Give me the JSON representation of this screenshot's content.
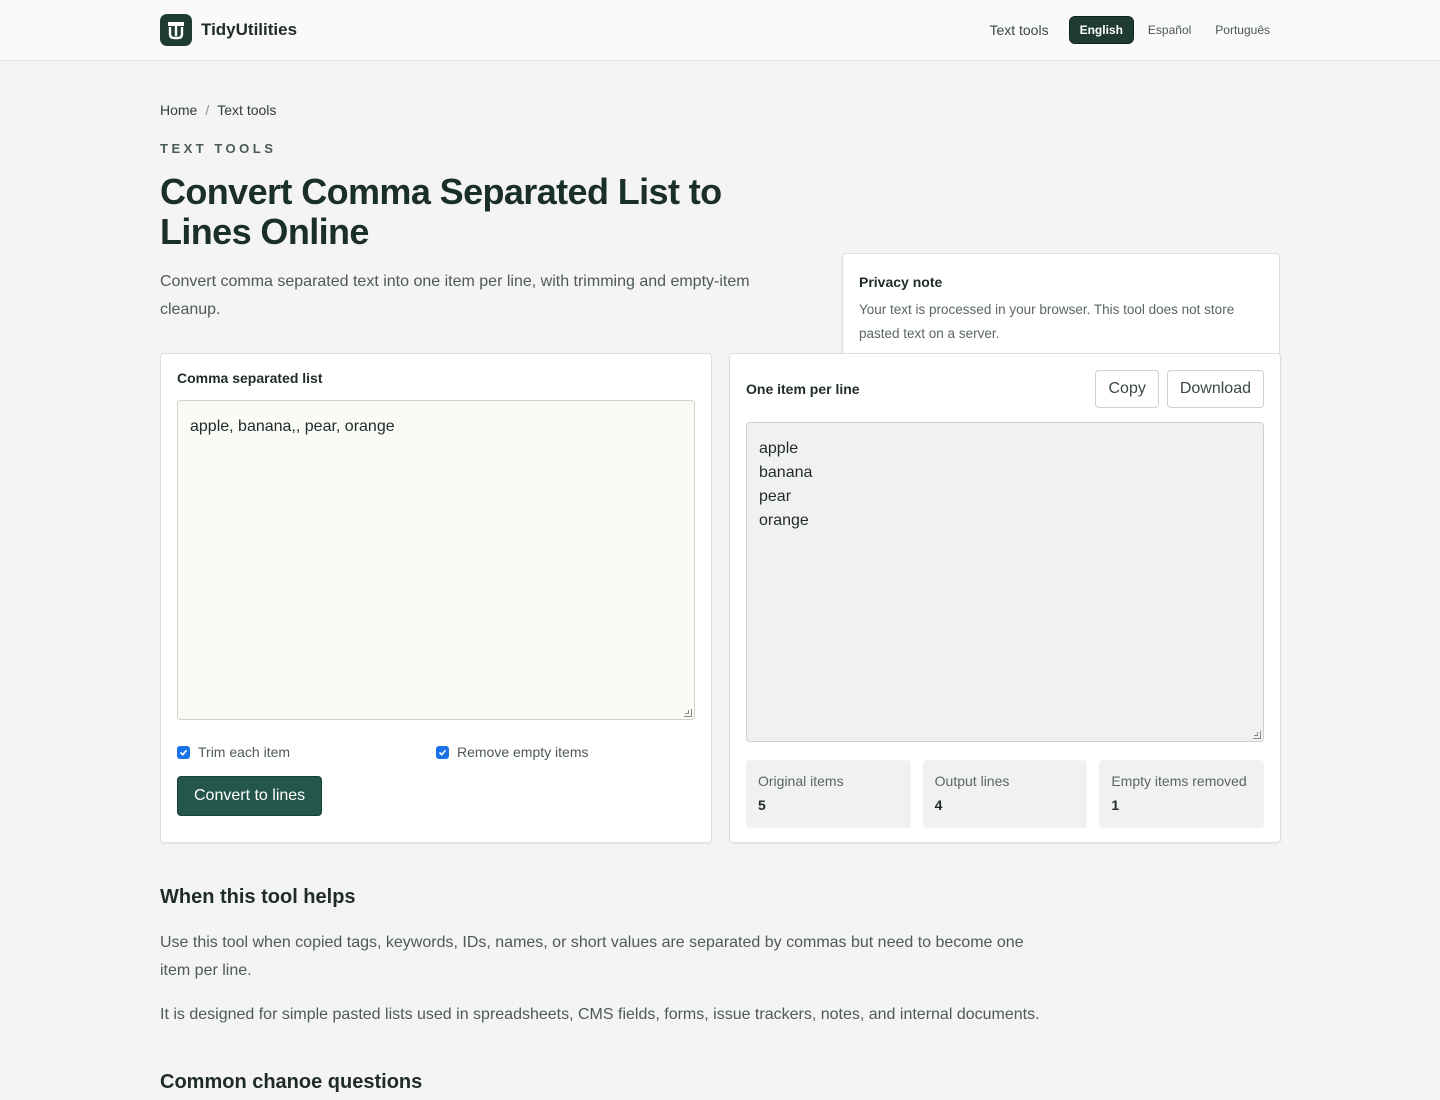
{
  "brand": {
    "name": "TidyUtilities"
  },
  "nav": {
    "text_tools": "Text tools",
    "languages": [
      "English",
      "Español",
      "Português"
    ],
    "active_language": "English"
  },
  "breadcrumb": {
    "home": "Home",
    "separator": "/",
    "current": "Text tools"
  },
  "eyebrow": "TEXT TOOLS",
  "title": "Convert Comma Separated List to Lines Online",
  "lede": "Convert comma separated text into one item per line, with trimming and empty-item cleanup.",
  "privacy": {
    "title": "Privacy note",
    "text": "Your text is processed in your browser. This tool does not store pasted text on a server."
  },
  "input_panel": {
    "label": "Comma separated list",
    "value": "apple, banana,, pear, orange",
    "options": [
      {
        "label": "Trim each item",
        "checked": true
      },
      {
        "label": "Remove empty items",
        "checked": true
      }
    ],
    "convert_label": "Convert to lines"
  },
  "output_panel": {
    "label": "One item per line",
    "copy_label": "Copy",
    "download_label": "Download",
    "value": "apple\nbanana\npear\norange",
    "stats": [
      {
        "label": "Original items",
        "value": "5"
      },
      {
        "label": "Output lines",
        "value": "4"
      },
      {
        "label": "Empty items removed",
        "value": "1"
      }
    ]
  },
  "section_helps": {
    "heading": "When this tool helps",
    "paragraphs": [
      "Use this tool when copied tags, keywords, IDs, names, or short values are separated by commas but need to become one item per line.",
      "It is designed for simple pasted lists used in spreadsheets, CMS fields, forms, issue trackers, notes, and internal documents."
    ]
  },
  "section_next": {
    "heading": "Common chanoe questions"
  },
  "colors": {
    "accent": "#24574a",
    "brand_dark": "#1f3b33",
    "checkbox": "#1a73e8"
  }
}
